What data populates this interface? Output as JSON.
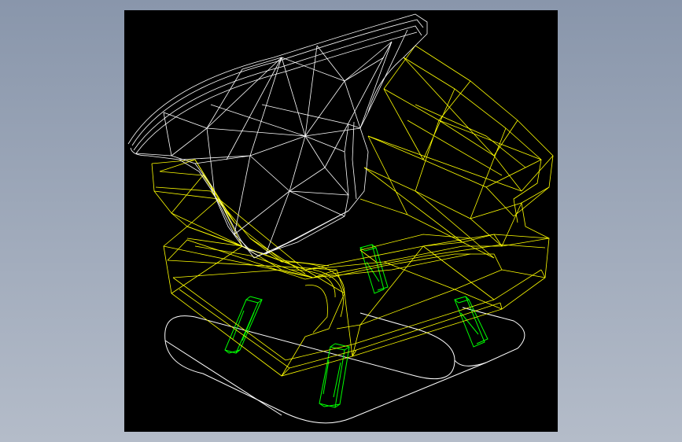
{
  "colors": {
    "background_top": "#8996ab",
    "background_bottom": "#b4bcc9",
    "viewport": "#000000",
    "backrest_wire": "#ffffff",
    "body_wire": "#ffff00",
    "legs_wire": "#00ff00",
    "footprint_outline": "#ffffff"
  },
  "viewport": {
    "content": "wireframe-armchair-model",
    "render_mode": "wireframe"
  }
}
